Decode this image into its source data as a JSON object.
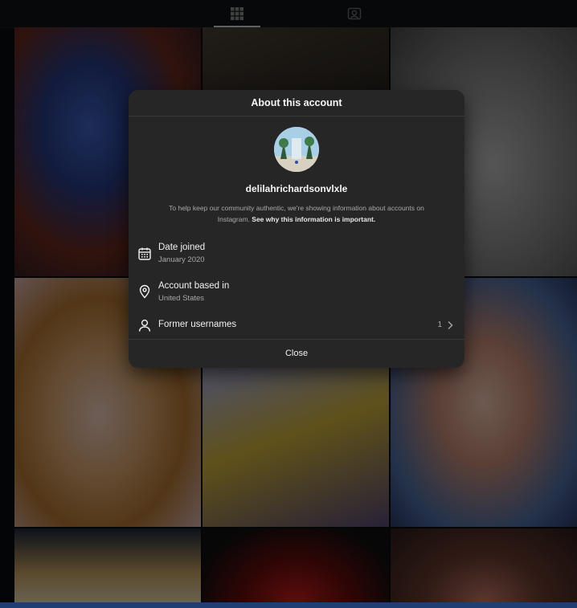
{
  "modal": {
    "title": "About this account",
    "username": "delilahrichardsonvlxle",
    "description_prefix": "To help keep our community authentic, we're showing information about accounts on Instagram.",
    "description_link": "See why this information is important.",
    "rows": [
      {
        "icon": "calendar-icon",
        "title": "Date joined",
        "subtitle": "January 2020"
      },
      {
        "icon": "location-pin-icon",
        "title": "Account based in",
        "subtitle": "United States"
      },
      {
        "icon": "person-icon",
        "title": "Former usernames",
        "count": "1"
      }
    ],
    "close_label": "Close"
  },
  "tabs": [
    {
      "icon": "grid-icon",
      "active": true
    },
    {
      "icon": "tagged-icon",
      "active": false
    }
  ],
  "colors": {
    "modal_bg": "#262626",
    "page_bg": "#0b0d10",
    "muted_text": "#a8a8a8"
  }
}
